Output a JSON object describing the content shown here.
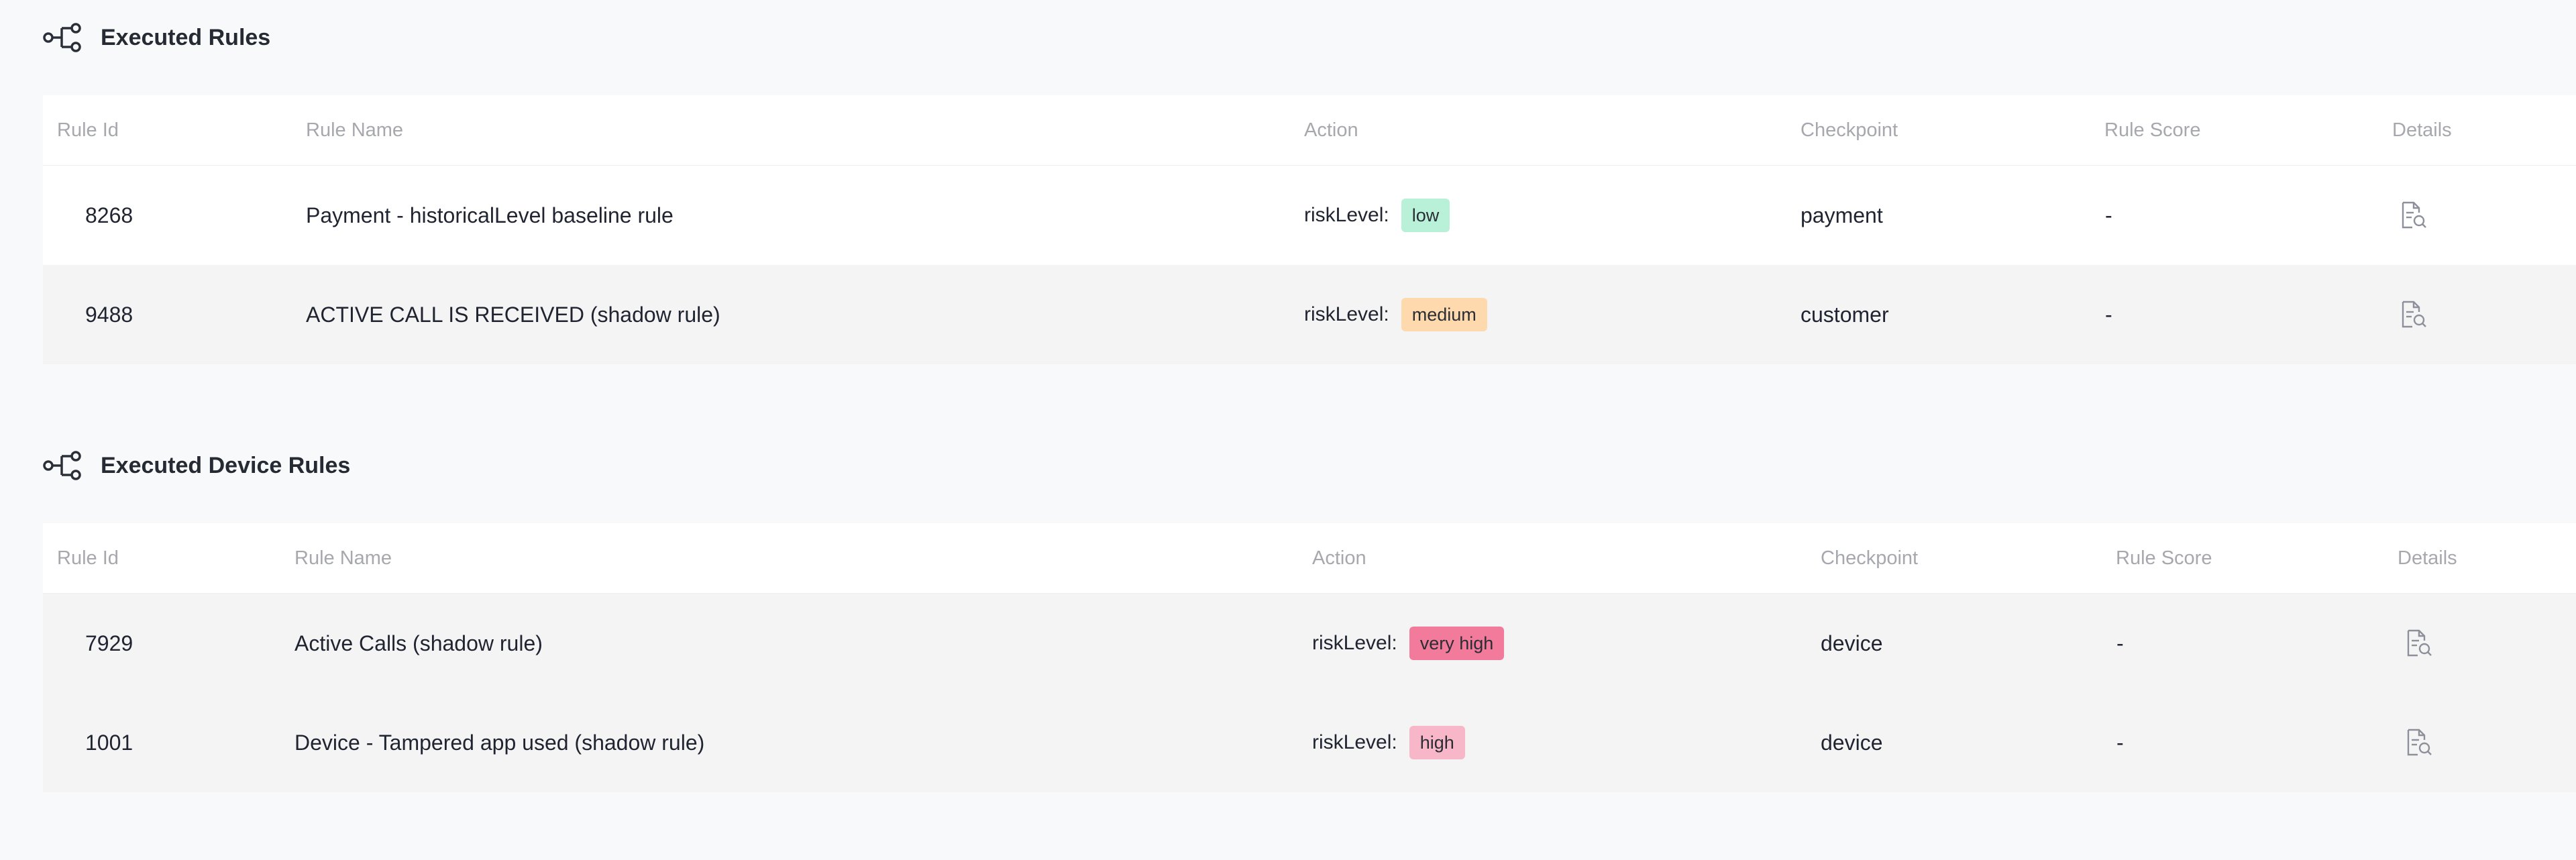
{
  "colors": {
    "low": "#b8f0d8",
    "medium": "#fdd9ad",
    "very_high": "#f27a9b",
    "high": "#f8b7c8"
  },
  "sections": [
    {
      "title": "Executed Rules",
      "icon": "workflow-icon",
      "headers": {
        "rule_id": "Rule Id",
        "rule_name": "Rule Name",
        "action": "Action",
        "checkpoint": "Checkpoint",
        "rule_score": "Rule Score",
        "details": "Details"
      },
      "rows": [
        {
          "rule_id": "8268",
          "rule_name": "Payment - historicalLevel baseline rule",
          "action_key": "riskLevel:",
          "action_value": "low",
          "checkpoint": "payment",
          "rule_score": "-",
          "details_icon": "document-search-icon"
        },
        {
          "rule_id": "9488",
          "rule_name": "ACTIVE CALL IS RECEIVED (shadow rule)",
          "action_key": "riskLevel:",
          "action_value": "medium",
          "checkpoint": "customer",
          "rule_score": "-",
          "details_icon": "document-search-icon"
        }
      ]
    },
    {
      "title": "Executed Device Rules",
      "icon": "workflow-icon",
      "headers": {
        "rule_id": "Rule Id",
        "rule_name": "Rule Name",
        "action": "Action",
        "checkpoint": "Checkpoint",
        "rule_score": "Rule Score",
        "details": "Details"
      },
      "rows": [
        {
          "rule_id": "7929",
          "rule_name": "Active Calls (shadow rule)",
          "action_key": "riskLevel:",
          "action_value": "very high",
          "checkpoint": "device",
          "rule_score": "-",
          "details_icon": "document-search-icon"
        },
        {
          "rule_id": "1001",
          "rule_name": "Device - Tampered app used (shadow rule)",
          "action_key": "riskLevel:",
          "action_value": "high",
          "checkpoint": "device",
          "rule_score": "-",
          "details_icon": "document-search-icon"
        }
      ]
    }
  ]
}
